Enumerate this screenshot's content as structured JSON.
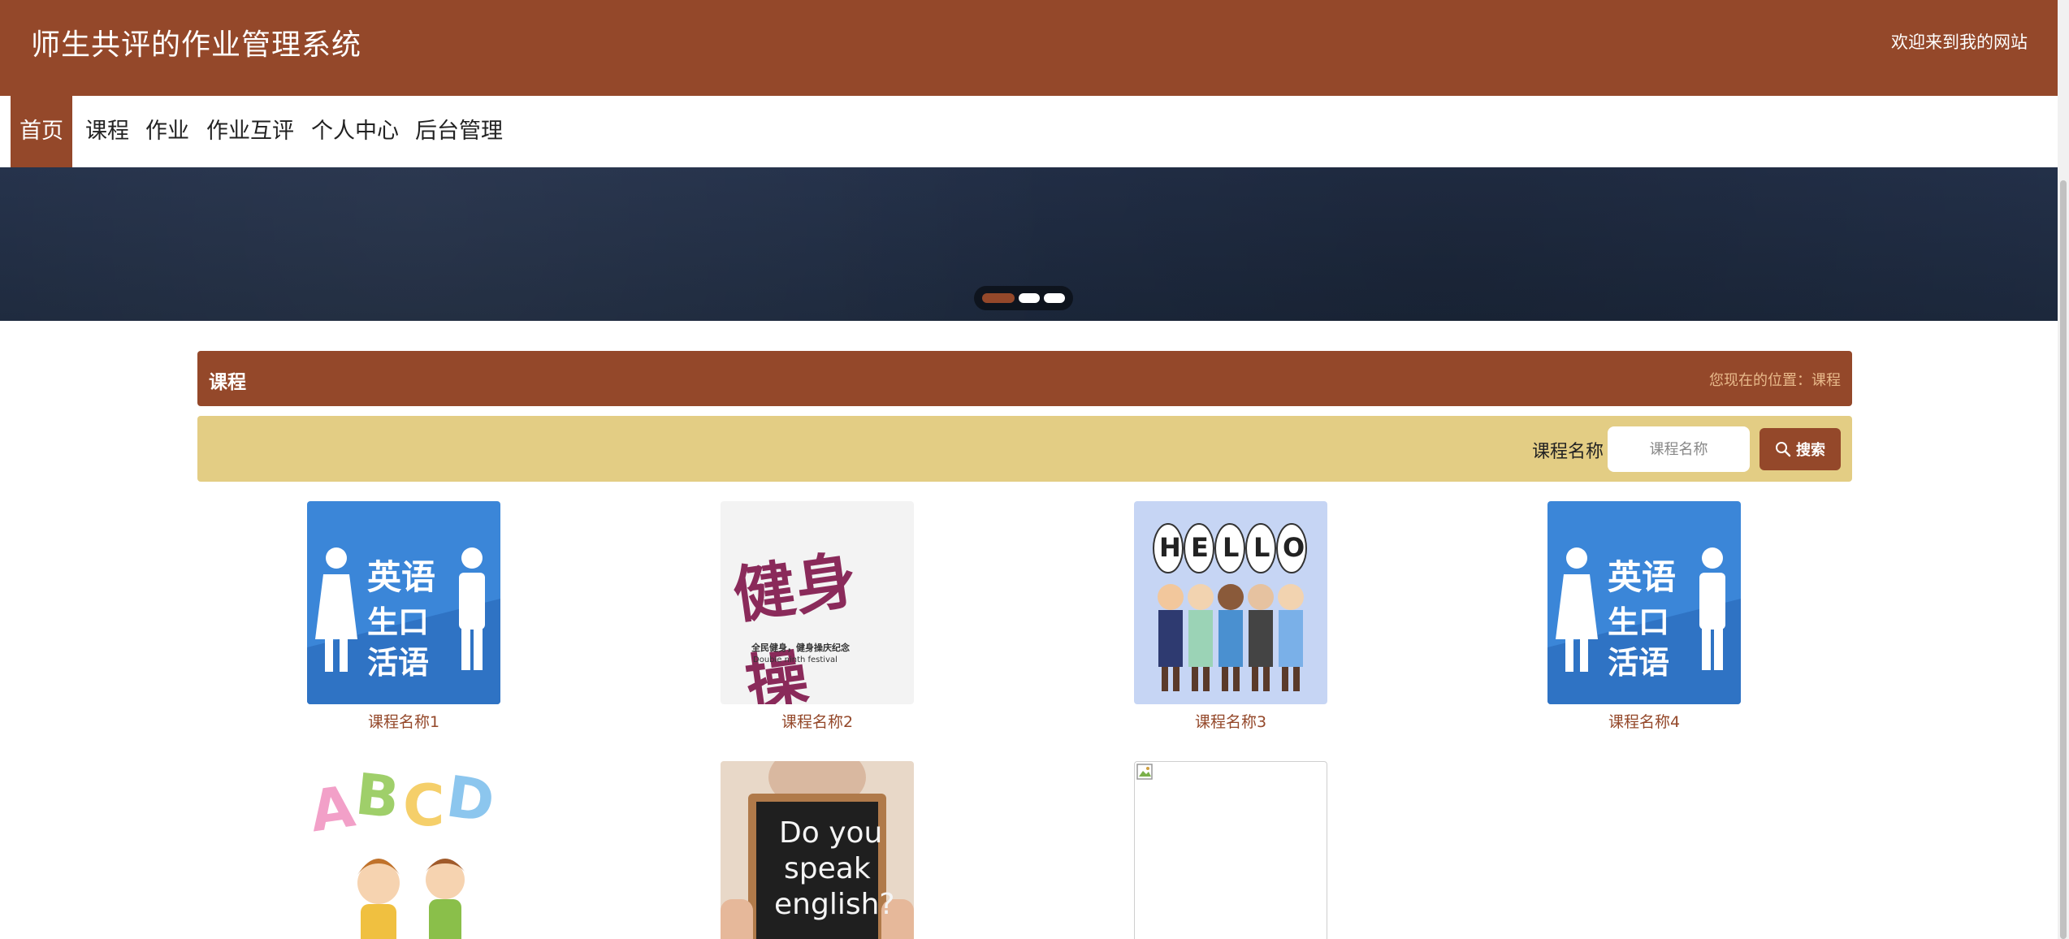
{
  "header": {
    "title": "师生共评的作业管理系统",
    "welcome": "欢迎来到我的网站"
  },
  "nav": {
    "items": [
      {
        "label": "首页",
        "active": true
      },
      {
        "label": "课程"
      },
      {
        "label": "作业"
      },
      {
        "label": "作业互评"
      },
      {
        "label": "个人中心"
      },
      {
        "label": "后台管理"
      }
    ]
  },
  "carousel": {
    "active_index": 0,
    "count": 3
  },
  "section": {
    "title": "课程",
    "breadcrumb": "您现在的位置：课程"
  },
  "search": {
    "label": "课程名称",
    "placeholder": "课程名称",
    "button_label": "搜索"
  },
  "courses": [
    {
      "name": "课程名称1"
    },
    {
      "name": "课程名称2"
    },
    {
      "name": "课程名称3"
    },
    {
      "name": "课程名称4"
    },
    {
      "name": ""
    },
    {
      "name": ""
    },
    {
      "name": ""
    }
  ],
  "images": {
    "english_spoken": {
      "line1": "英语",
      "line2": "生口",
      "line3": "活语"
    },
    "fitness": {
      "title": "健身操",
      "caption1": "全民健身，健身操庆纪念",
      "caption2": "Double ninth festival"
    },
    "hello": [
      "H",
      "E",
      "L",
      "L",
      "O"
    ],
    "abcd": [
      "A",
      "B",
      "C",
      "D"
    ],
    "speak": {
      "line1": "Do you",
      "line2": "speak",
      "line3": "english?"
    }
  },
  "colors": {
    "primary": "#94482a",
    "search_bar": "#e3cd84",
    "breadcrumb": "#e8b98a"
  }
}
